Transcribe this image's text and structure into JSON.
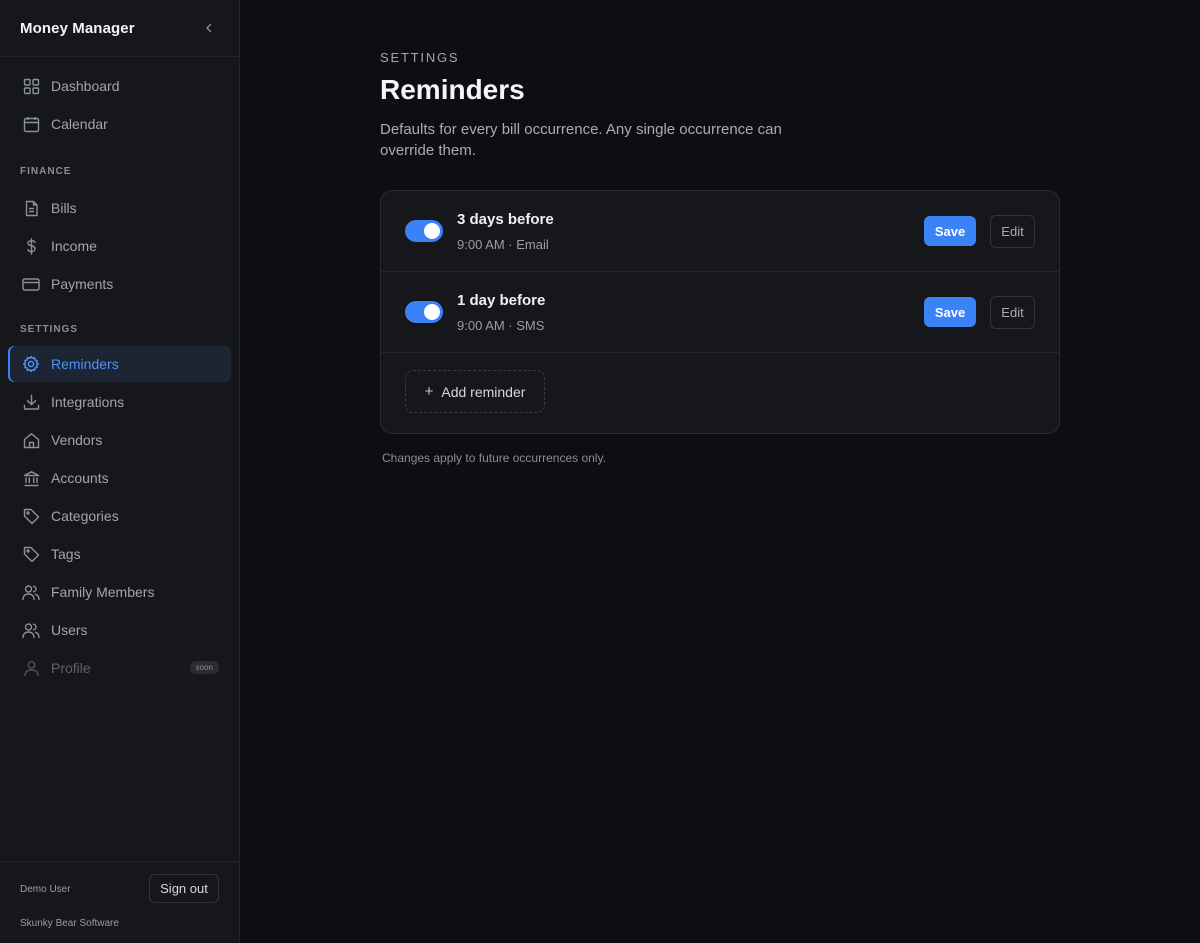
{
  "app": {
    "title": "Money Manager"
  },
  "sidebar": {
    "top_items": [
      {
        "label": "Dashboard",
        "icon": "dashboard-icon"
      },
      {
        "label": "Calendar",
        "icon": "calendar-icon"
      }
    ],
    "finance_label": "FINANCE",
    "finance_items": [
      {
        "label": "Bills",
        "icon": "file-icon"
      },
      {
        "label": "Income",
        "icon": "dollar-icon"
      },
      {
        "label": "Payments",
        "icon": "card-icon"
      }
    ],
    "settings_label": "SETTINGS",
    "settings_items": [
      {
        "label": "Reminders",
        "icon": "gear-icon",
        "active": true
      },
      {
        "label": "Integrations",
        "icon": "download-icon"
      },
      {
        "label": "Vendors",
        "icon": "home-icon"
      },
      {
        "label": "Accounts",
        "icon": "bank-icon"
      },
      {
        "label": "Categories",
        "icon": "tag-icon"
      },
      {
        "label": "Tags",
        "icon": "tag-icon"
      },
      {
        "label": "Family Members",
        "icon": "users-icon"
      },
      {
        "label": "Users",
        "icon": "users-icon"
      },
      {
        "label": "Profile",
        "icon": "user-icon",
        "disabled": true,
        "badge": "soon"
      }
    ],
    "footer": {
      "user": "Demo User",
      "signout_label": "Sign out",
      "company": "Skunky Bear Software"
    }
  },
  "main": {
    "eyebrow": "SETTINGS",
    "title": "Reminders",
    "description": "Defaults for every bill occurrence. Any single occurrence can override them.",
    "reminders": [
      {
        "title": "3 days before",
        "subtitle": "9:00 AM · Email",
        "enabled": true,
        "save_label": "Save",
        "edit_label": "Edit"
      },
      {
        "title": "1 day before",
        "subtitle": "9:00 AM · SMS",
        "enabled": true,
        "save_label": "Save",
        "edit_label": "Edit"
      }
    ],
    "add_label": "Add reminder",
    "note": "Changes apply to future occurrences only."
  },
  "colors": {
    "accent": "#3b82f6",
    "background": "#0d0e11",
    "sidebar": "#16171b"
  }
}
